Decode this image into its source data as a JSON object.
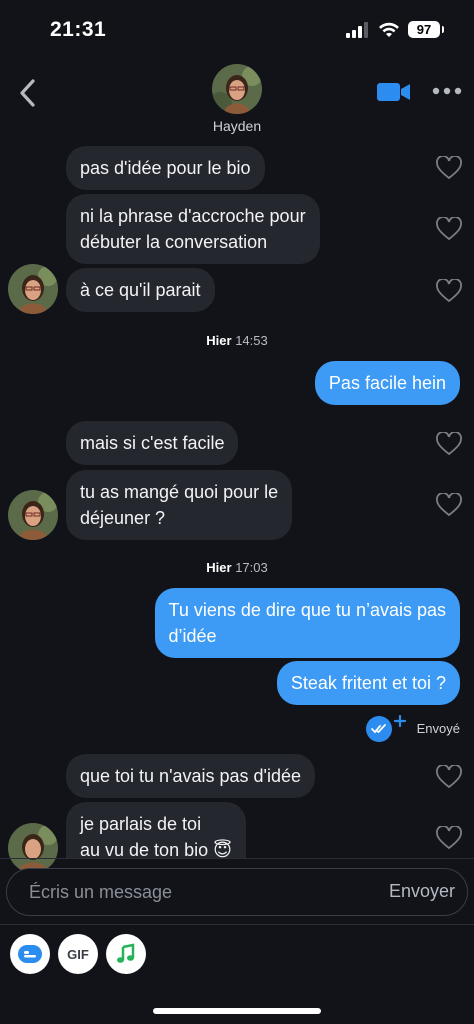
{
  "status_bar": {
    "time": "21:31",
    "battery": "97"
  },
  "header": {
    "contact_name": "Hayden"
  },
  "messages": [
    {
      "text": "pas d'idée pour le bio"
    },
    {
      "text_line1": "ni la phrase d'accroche pour",
      "text_line2": "débuter la conversation"
    },
    {
      "text": "à ce qu'il parait"
    },
    {
      "timestamp_day": "Hier",
      "timestamp_time": "14:53"
    },
    {
      "text": "Pas facile hein"
    },
    {
      "text": "mais si c'est facile"
    },
    {
      "text_line1": "tu as mangé quoi pour le",
      "text_line2": "déjeuner ?"
    },
    {
      "timestamp_day": "Hier",
      "timestamp_time": "17:03"
    },
    {
      "text_line1": "Tu viens de dire que tu n’avais pas",
      "text_line2": "d’idée"
    },
    {
      "text": "Steak fritent et toi ?"
    },
    {
      "status": "Envoyé"
    },
    {
      "text": "que toi tu n'avais pas d'idée"
    },
    {
      "text_line1": "je parlais de toi",
      "text_line2": "au vu de ton bio 😇"
    }
  ],
  "composer": {
    "placeholder": "Écris un message",
    "send_label": "Envoyer"
  },
  "tools": {
    "gif_label": "GIF"
  },
  "colors": {
    "background": "#111319",
    "incoming_bubble": "#25272e",
    "outgoing_bubble": "#3d9bf5",
    "accent": "#2d8cf0"
  },
  "icons": [
    "back-icon",
    "video-call-icon",
    "more-icon",
    "heart-icon",
    "read-receipt-icon",
    "sticker-icon",
    "music-icon"
  ]
}
